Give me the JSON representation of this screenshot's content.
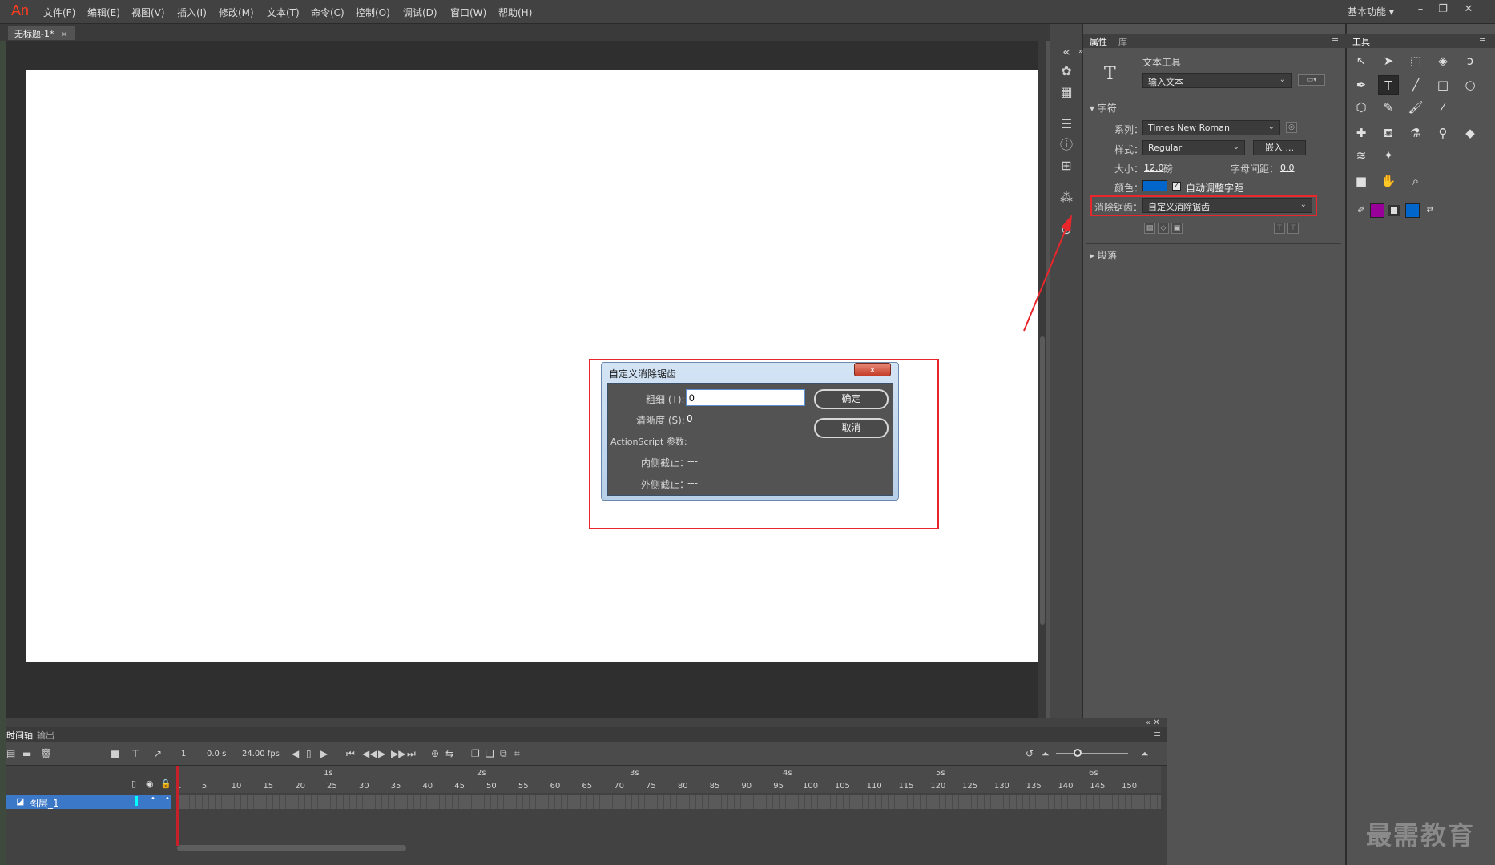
{
  "app": {
    "logo": "An",
    "workspace": "基本功能"
  },
  "menu": [
    "文件(F)",
    "编辑(E)",
    "视图(V)",
    "插入(I)",
    "修改(M)",
    "文本(T)",
    "命令(C)",
    "控制(O)",
    "调试(D)",
    "窗口(W)",
    "帮助(H)"
  ],
  "window_controls": {
    "minimize": "–",
    "restore": "❐",
    "close": "✕"
  },
  "document": {
    "tab_title": "无标题-1*",
    "tab_close": "×"
  },
  "properties": {
    "tabs": [
      "属性",
      "库"
    ],
    "tool_name": "文本工具",
    "text_type": "输入文本",
    "section_char": "字符",
    "family_label": "系列：",
    "family_value": "Times New Roman",
    "style_label": "样式：",
    "style_value": "Regular",
    "embed_button": "嵌入 ...",
    "size_label": "大小：",
    "size_value": "12.0",
    "size_unit": "磅",
    "spacing_label": "字母间距：",
    "spacing_value": "0.0",
    "color_label": "颜色：",
    "color_value": "#0066cc",
    "kerning_label": "自动调整字距",
    "antialias_label": "消除锯齿：",
    "antialias_value": "自定义消除锯齿",
    "section_para": "段落"
  },
  "tools": {
    "header": "工具"
  },
  "dialog": {
    "title": "自定义消除锯齿",
    "close": "x",
    "thickness_label": "粗细 (T):",
    "thickness_value": "0",
    "sharpness_label": "清晰度 (S):",
    "sharpness_value": "0",
    "as_params_label": "ActionScript 参数:",
    "inner_label": "内侧截止：",
    "inner_value": "---",
    "outer_label": "外侧截止：",
    "outer_value": "---",
    "ok_button": "确定",
    "cancel_button": "取消"
  },
  "timeline": {
    "tabs": [
      "时间轴",
      "输出"
    ],
    "frame": "1",
    "time": "0.0 s",
    "fps": "24.00 fps",
    "seconds": [
      "1s",
      "2s",
      "3s",
      "4s",
      "5s",
      "6s"
    ],
    "frames": [
      "1",
      "5",
      "10",
      "15",
      "20",
      "25",
      "30",
      "35",
      "40",
      "45",
      "50",
      "55",
      "60",
      "65",
      "70",
      "75",
      "80",
      "85",
      "90",
      "95",
      "100",
      "105",
      "110",
      "115",
      "120",
      "125",
      "130",
      "135",
      "140",
      "145",
      "150"
    ],
    "layer_name": "图层_1"
  },
  "watermark": "最需教育"
}
